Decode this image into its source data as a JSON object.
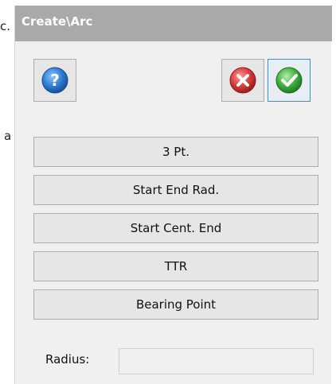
{
  "background": {
    "fragment_top": "c.",
    "fragment_mid": "a"
  },
  "window": {
    "title": "Create\\Arc"
  },
  "toolbar": {
    "help_icon": "question-mark-icon",
    "cancel_icon": "red-x-icon",
    "ok_icon": "green-check-icon"
  },
  "buttons": [
    {
      "label": "3 Pt."
    },
    {
      "label": "Start End Rad."
    },
    {
      "label": "Start Cent. End"
    },
    {
      "label": "TTR"
    },
    {
      "label": "Bearing Point"
    }
  ],
  "radius": {
    "label": "Radius:",
    "value": "",
    "placeholder": ""
  },
  "colors": {
    "titlebar": "#a9a9a9",
    "panel": "#f0f0f0",
    "help_blue": "#2e7bd6",
    "cancel_red": "#d83b3b",
    "ok_green": "#3fae3f",
    "focus_border": "#3c8fdc"
  }
}
